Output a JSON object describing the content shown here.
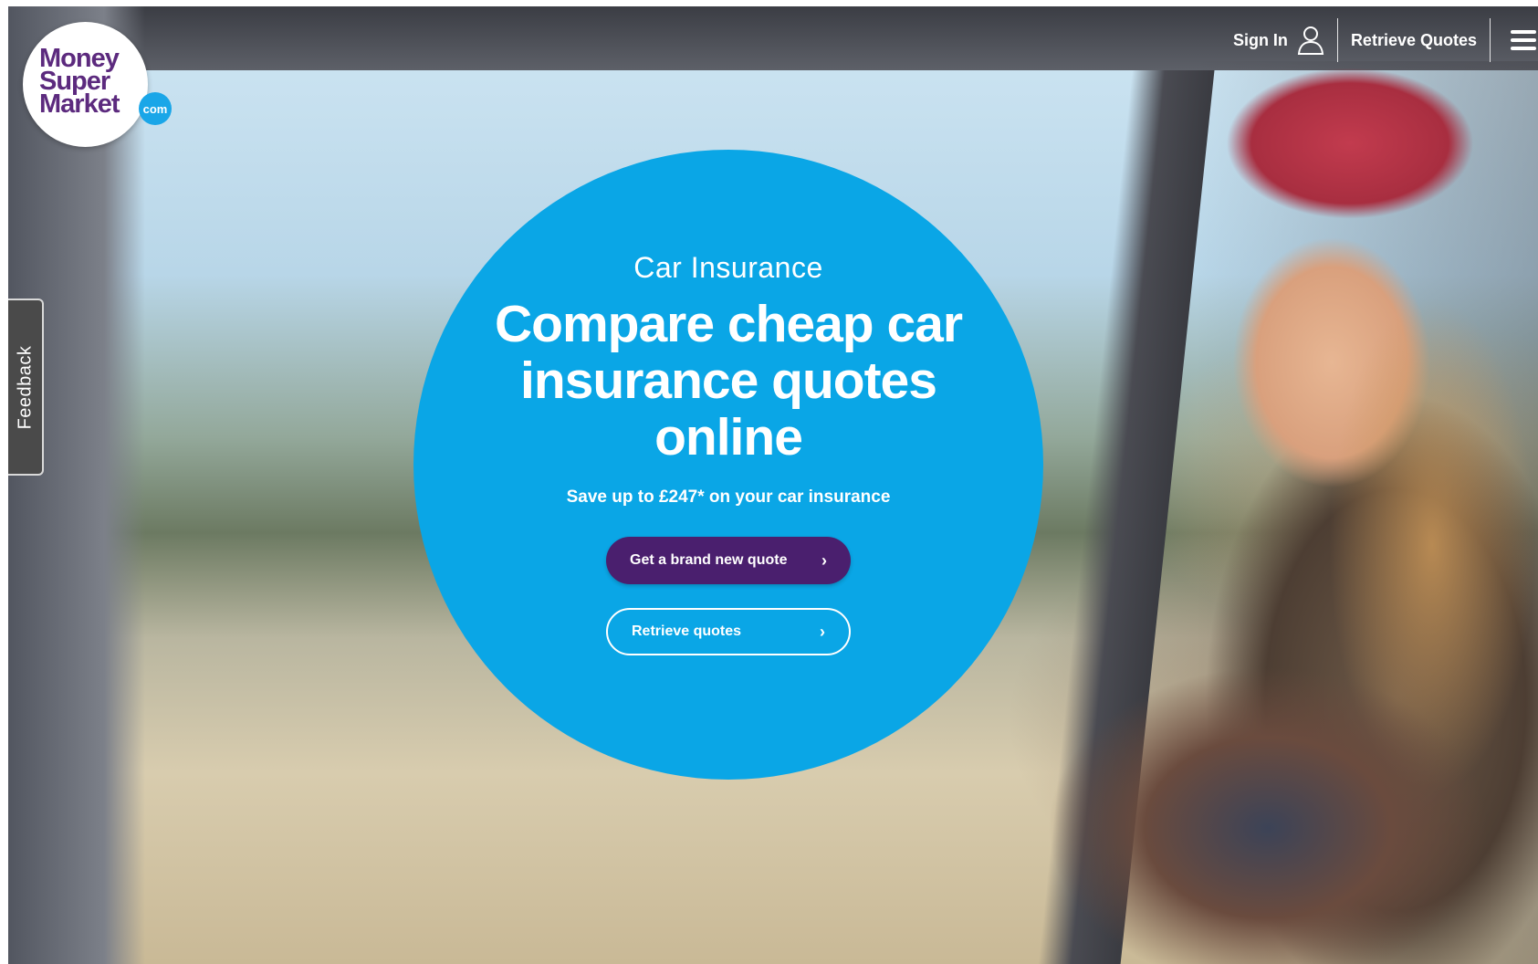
{
  "header": {
    "logo": {
      "line1": "Money",
      "line2": "Super",
      "line3": "Market",
      "suffix": "com"
    },
    "sign_in_label": "Sign In",
    "retrieve_quotes_label": "Retrieve Quotes"
  },
  "feedback_label": "Feedback",
  "hero": {
    "eyebrow": "Car Insurance",
    "title": "Compare cheap car insurance quotes online",
    "subtitle": "Save up to £247* on your car insurance",
    "primary_button": "Get a brand new quote",
    "secondary_button": "Retrieve quotes"
  },
  "colors": {
    "brand_purple": "#4a1f6e",
    "hero_blue": "#0aa6e6",
    "logo_purple": "#5c2a7e",
    "com_blue": "#1aa6e8"
  },
  "icons": {
    "user": "user-icon",
    "menu": "hamburger-menu-icon",
    "chevron": "chevron-right-icon"
  }
}
